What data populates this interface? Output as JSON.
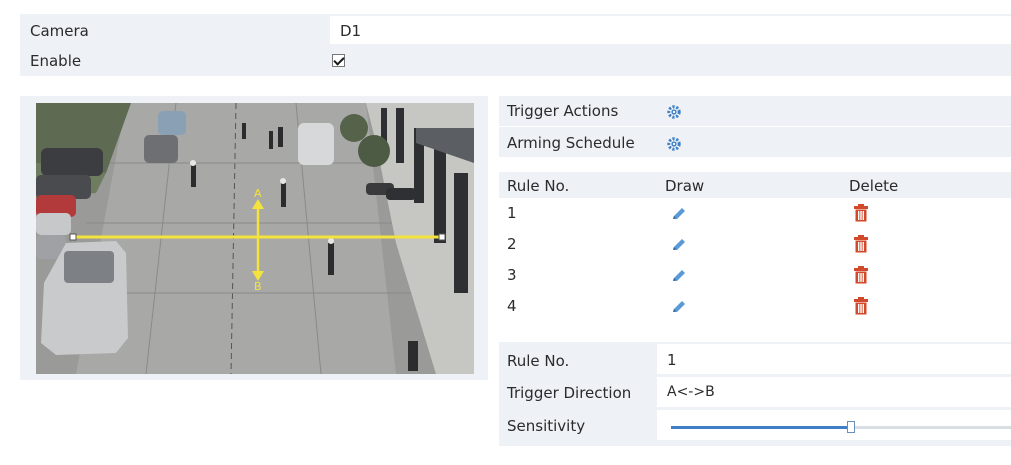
{
  "config": {
    "camera_label": "Camera",
    "camera_value": "D1",
    "enable_label": "Enable",
    "enable_checked": true
  },
  "video": {
    "marker_a": "A",
    "marker_b": "B"
  },
  "actions": {
    "trigger_actions_label": "Trigger Actions",
    "arming_schedule_label": "Arming Schedule"
  },
  "rules": {
    "header": {
      "rule_no": "Rule No.",
      "draw": "Draw",
      "delete": "Delete"
    },
    "rows": [
      "1",
      "2",
      "3",
      "4"
    ]
  },
  "params": {
    "rule_no_label": "Rule No.",
    "rule_no_value": "1",
    "trigger_direction_label": "Trigger Direction",
    "trigger_direction_value": "A<->B",
    "sensitivity_label": "Sensitivity",
    "sensitivity_value": 0.53
  },
  "colors": {
    "panel_bg": "#eef1f5",
    "accent_blue": "#3e7fc8",
    "line_yellow": "#f3e33c",
    "delete_red": "#d2482a"
  }
}
